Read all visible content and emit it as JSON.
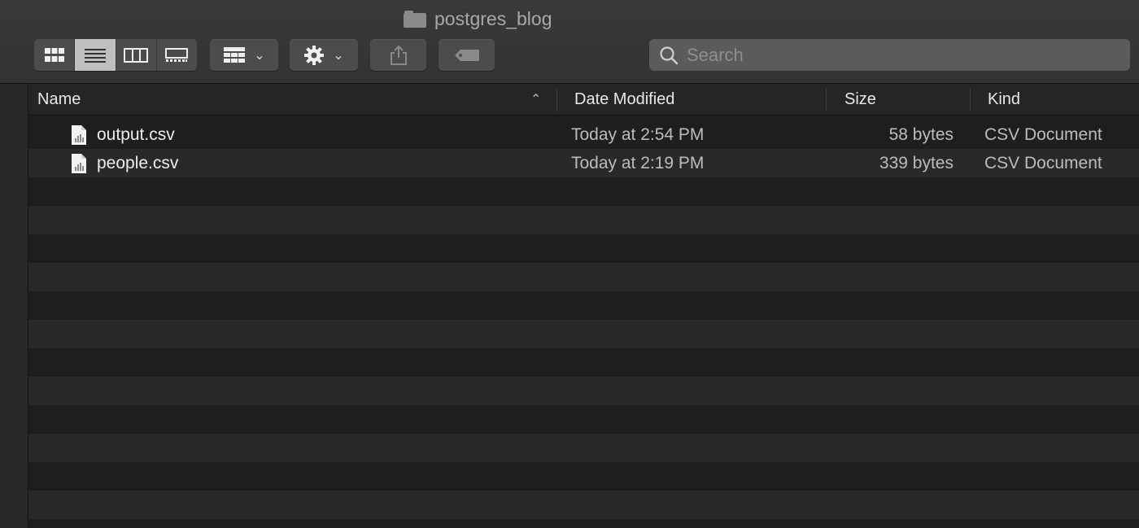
{
  "window": {
    "title": "postgres_blog",
    "folder_icon": "folder-icon"
  },
  "toolbar": {
    "view_modes": [
      {
        "name": "icon-view",
        "icon": "grid-icon",
        "active": false
      },
      {
        "name": "list-view",
        "icon": "list-icon",
        "active": true
      },
      {
        "name": "column-view",
        "icon": "columns-icon",
        "active": false
      },
      {
        "name": "gallery-view",
        "icon": "gallery-icon",
        "active": false
      }
    ],
    "group_icon": "group-grid-icon",
    "action_icon": "gear-icon",
    "share_icon": "share-icon",
    "tags_icon": "tag-icon",
    "chevron": "⌄"
  },
  "search": {
    "placeholder": "Search",
    "value": ""
  },
  "columns": {
    "name": "Name",
    "date": "Date Modified",
    "size": "Size",
    "kind": "Kind",
    "sort_indicator": "⌃"
  },
  "files": [
    {
      "name": "output.csv",
      "date": "Today at 2:54 PM",
      "size": "58 bytes",
      "kind": "CSV Document"
    },
    {
      "name": "people.csv",
      "date": "Today at 2:19 PM",
      "size": "339 bytes",
      "kind": "CSV Document"
    }
  ],
  "colors": {
    "background": "#1e1e1e",
    "row_alt": "#2a292a",
    "toolbar": "#383637",
    "text": "#e6e6e6",
    "muted_text": "#bcbcbc"
  }
}
